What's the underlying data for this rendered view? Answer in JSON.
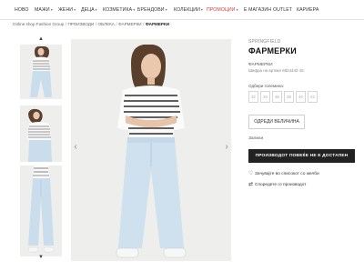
{
  "nav": {
    "items": [
      {
        "label": "НОВО"
      },
      {
        "label": "МАЖИ",
        "caret": "▾"
      },
      {
        "label": "ЖЕНИ",
        "caret": "▾"
      },
      {
        "label": "ДЕЦА",
        "caret": "▾"
      },
      {
        "label": "КОЗМЕТИКА",
        "caret": "▾"
      },
      {
        "label": "БРЕНДОВИ",
        "caret": "▾"
      },
      {
        "label": "КОЛЕКЦИИ",
        "caret": "▾"
      },
      {
        "label": "ПРОМОЦИИ",
        "caret": "▾"
      },
      {
        "label": "Е МАГАЗИН"
      },
      {
        "label": "OUTLET"
      },
      {
        "label": "КАРИЕРА"
      }
    ],
    "promo_color": "#d23a3a"
  },
  "breadcrumb": {
    "items": [
      "Online shop Fashion Group",
      "ПРОИЗВОДИ",
      "ОБЛЕКА",
      "ФАРМЕРКИ"
    ],
    "current": "ФАРМЕРКИ",
    "separator": "/"
  },
  "gallery": {
    "up_arrow": "▲",
    "down_arrow": "▼",
    "prev": "‹",
    "next": "›",
    "background": "#eeeeec"
  },
  "product": {
    "brand": "SPRINGFIELD",
    "title": "ФАРМЕРКИ",
    "subname": "ФАРМЕРКИ",
    "sku": "Шифра на артикл 6824442-15",
    "size_label": "Одбери големина:",
    "sizes": [
      "32",
      "34",
      "36",
      "38",
      "40",
      "42"
    ],
    "size_guide_label": "ОДРЕДИ ВЕЛИЧИНА",
    "stock_label": "Залихи",
    "soldout_label": "ПРОИЗВОДОТ ПОВЕЌЕ НЕ Е ДОСТАПЕН",
    "wishlist_label": "Зачувајте во списокот со желби",
    "compare_label": "Споредете го производот",
    "wishlist_icon": "heart-icon",
    "compare_icon": "compare-icon"
  }
}
